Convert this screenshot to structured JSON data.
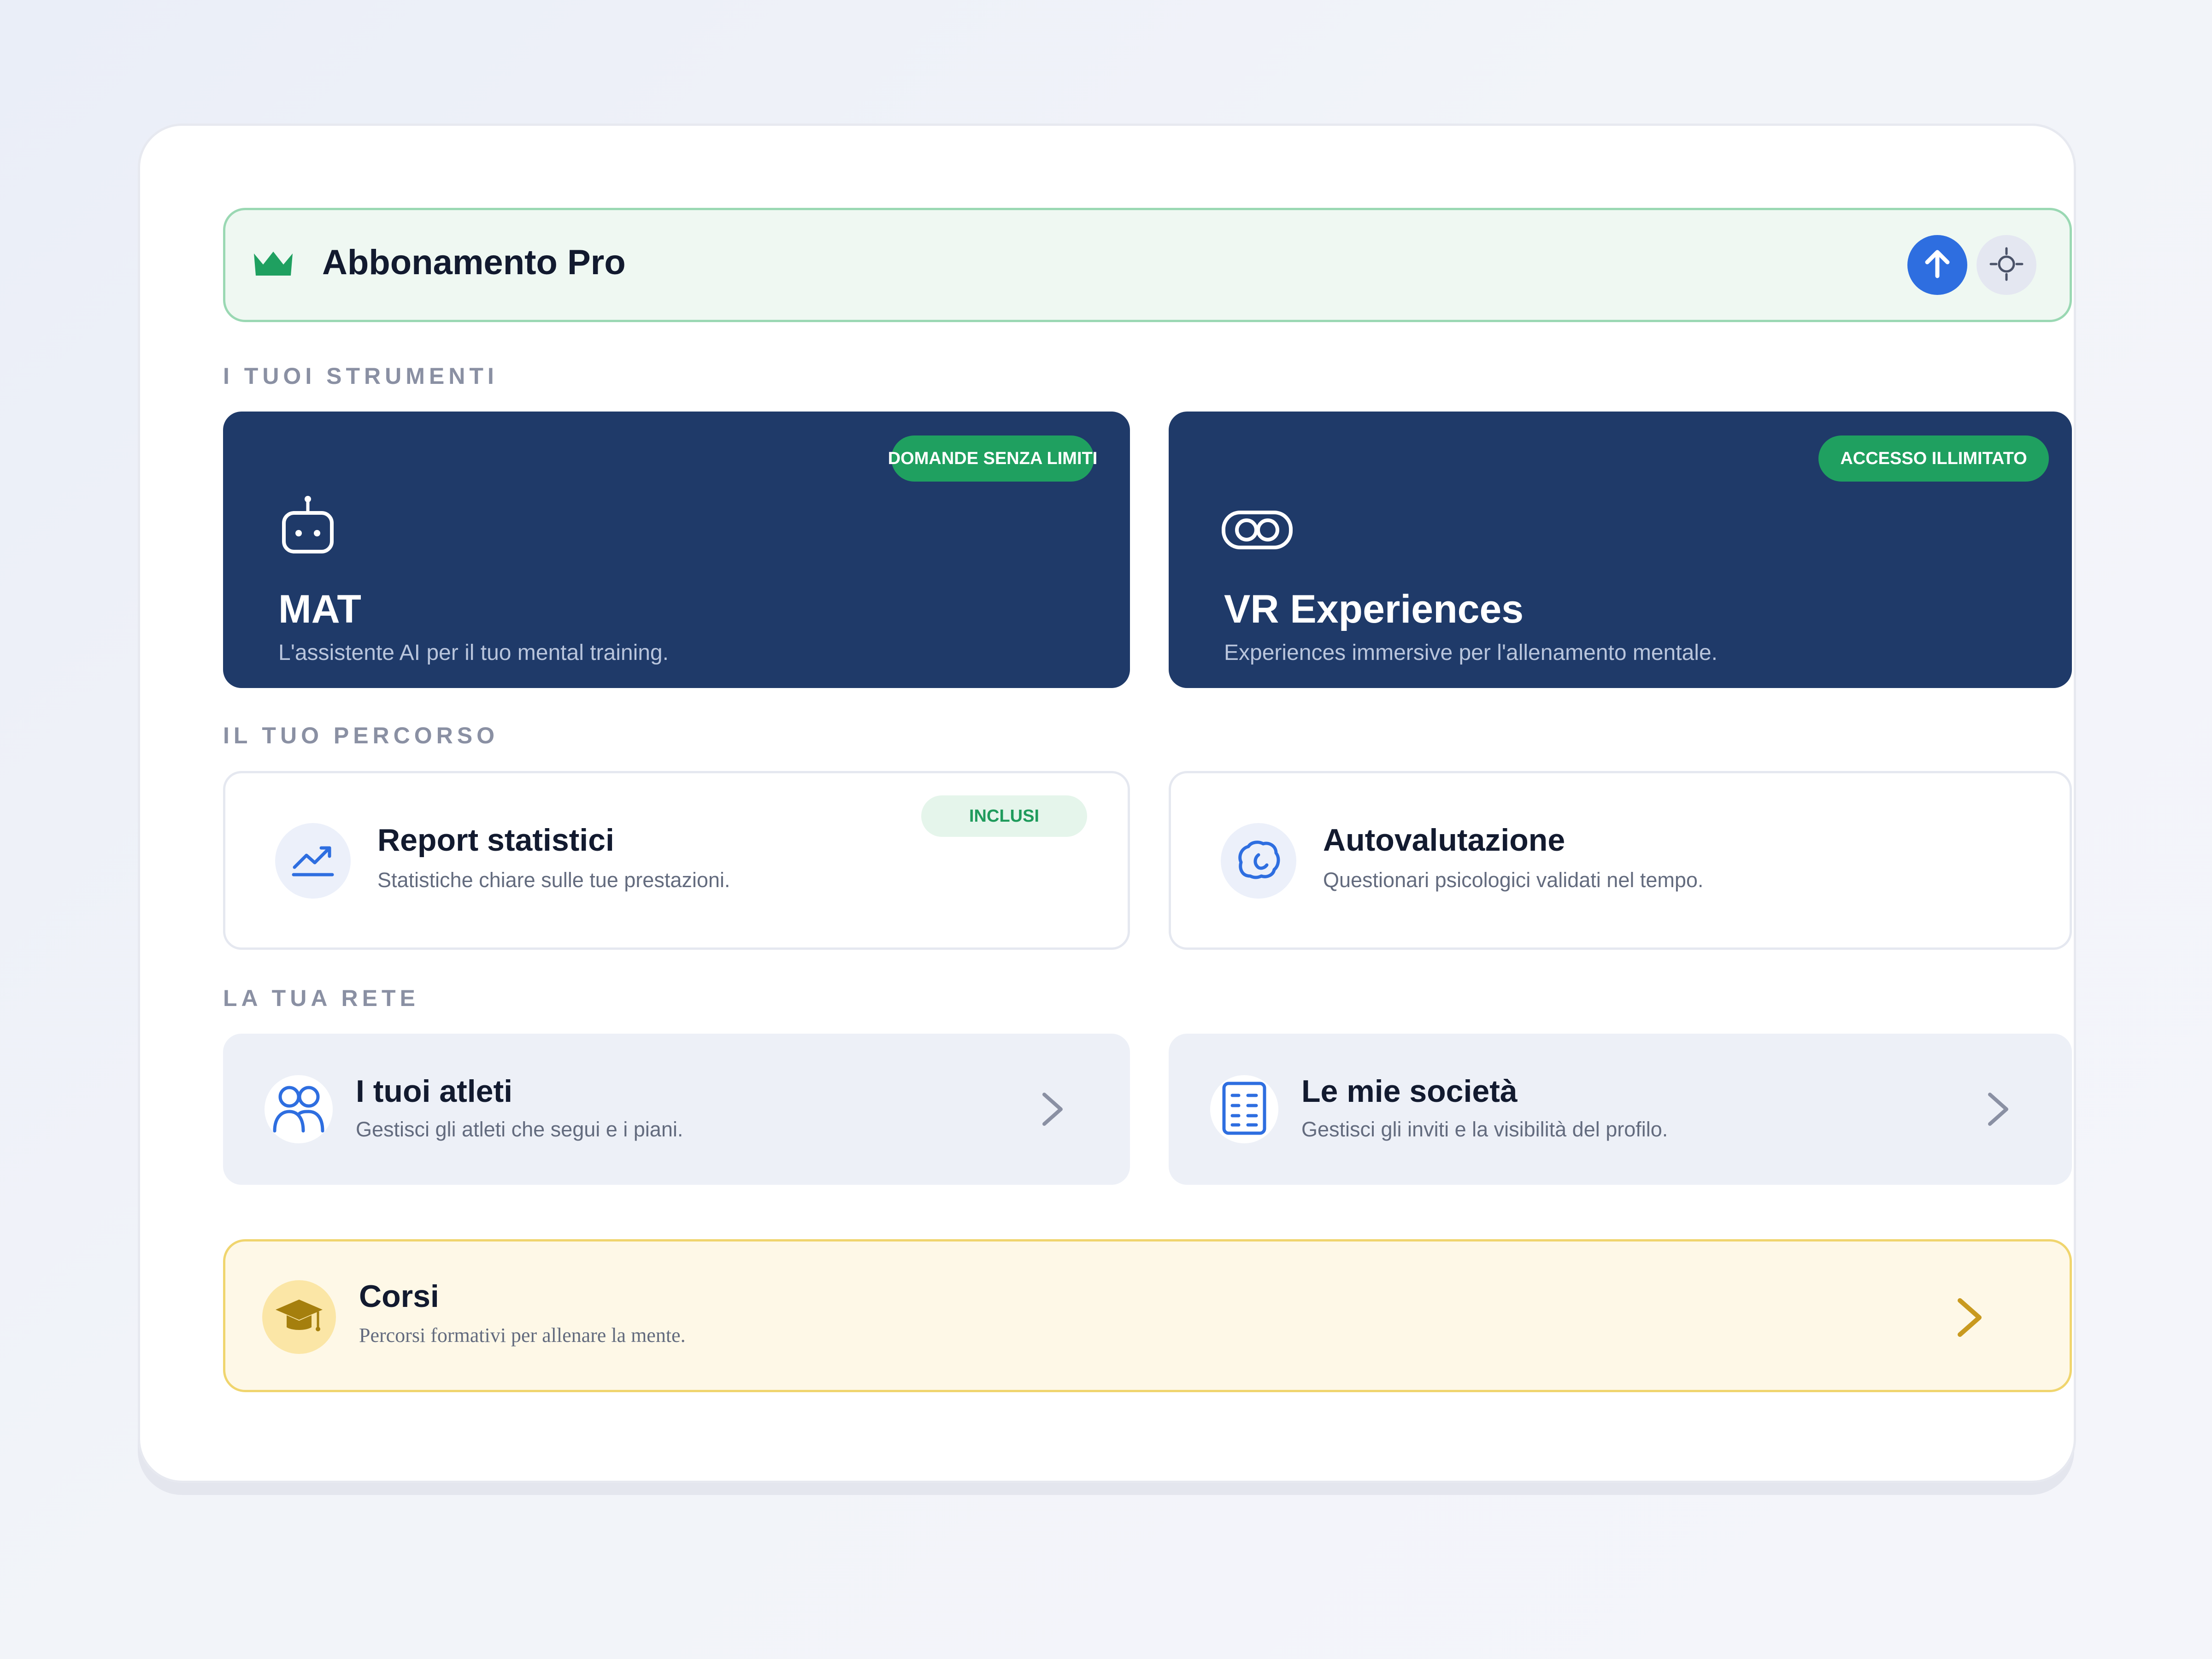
{
  "banner": {
    "title": "Abbonamento Pro",
    "icon": "crown-icon",
    "accent": "#1fa060"
  },
  "sections": {
    "tools": "I TUOI STRUMENTI",
    "path": "IL TUO PERCORSO",
    "network": "LA TUA RETE"
  },
  "tools": [
    {
      "badge": "DOMANDE SENZA LIMITI",
      "name": "MAT",
      "desc": "L'assistente AI per il tuo mental training.",
      "icon": "robot-icon"
    },
    {
      "badge": "ACCESSO ILLIMITATO",
      "name": "VR Experiences",
      "desc": "Experiences immersive per l'allenamento mentale.",
      "icon": "vr-headset-icon"
    }
  ],
  "path": [
    {
      "badge": "INCLUSI",
      "name": "Report statistici",
      "desc": "Statistiche chiare sulle tue prestazioni.",
      "icon": "chart-line-icon"
    },
    {
      "name": "Autovalutazione",
      "desc": "Questionari psicologici validati nel tempo.",
      "icon": "brain-icon"
    }
  ],
  "network": [
    {
      "name": "I tuoi atleti",
      "desc": "Gestisci gli atleti che segui e i piani.",
      "icon": "users-icon"
    },
    {
      "name": "Le mie società",
      "desc": "Gestisci gli inviti e la visibilità del profilo.",
      "icon": "building-icon"
    }
  ],
  "courses": {
    "name": "Corsi",
    "desc": "Percorsi formativi per allenare la mente.",
    "icon": "graduation-cap-icon"
  },
  "colors": {
    "navy": "#1f3a69",
    "blue": "#2e6ee0",
    "green": "#1fa060",
    "gold": "#c99a1f"
  }
}
